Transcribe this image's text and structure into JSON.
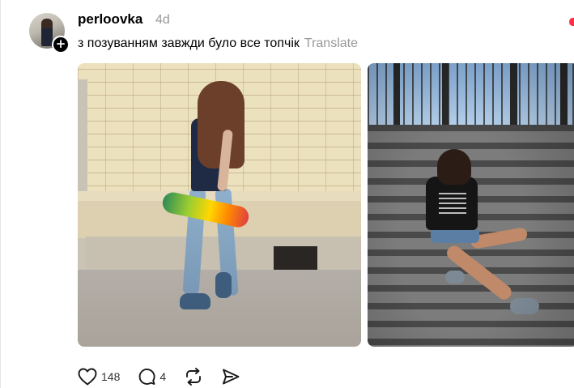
{
  "post": {
    "username": "perloovka",
    "time_ago": "4d",
    "follow_symbol": "+",
    "caption": "з позуванням завжди було все топчік",
    "translate_label": "Translate"
  },
  "media": {
    "photos": [
      {
        "alt": ""
      },
      {
        "alt": ""
      }
    ]
  },
  "actions": {
    "like_count": "148",
    "reply_count": "4"
  },
  "colors": {
    "secondary_text": "#999999",
    "like_accent": "#ff3040"
  },
  "icons": [
    "heart-icon",
    "comment-icon",
    "repost-icon",
    "share-icon",
    "plus-icon"
  ]
}
